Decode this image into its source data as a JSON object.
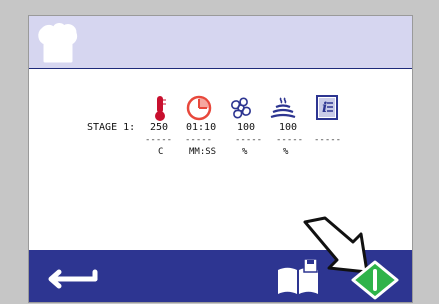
{
  "stage": {
    "label": "STAGE 1:",
    "temperature": "250",
    "time": "01:10",
    "fan": "100",
    "steam": "100"
  },
  "units": {
    "dashes": "-----",
    "temperature": "C",
    "time": "MM:SS",
    "fan": "%",
    "steam": "%"
  },
  "icons": {
    "header": "chef-hat-icon",
    "temperature": "thermometer-icon",
    "time": "clock-icon",
    "fan": "fan-icon",
    "steam": "steam-icon",
    "info": "info-icon",
    "back": "back-arrow-icon",
    "recipes": "recipe-book-icon",
    "start": "start-icon"
  },
  "colors": {
    "header_bg": "#d6d6f0",
    "footer_bg": "#2d3591",
    "thermometer": "#c8102e",
    "clock": "#e8483c",
    "start_green": "#2fb34a"
  }
}
